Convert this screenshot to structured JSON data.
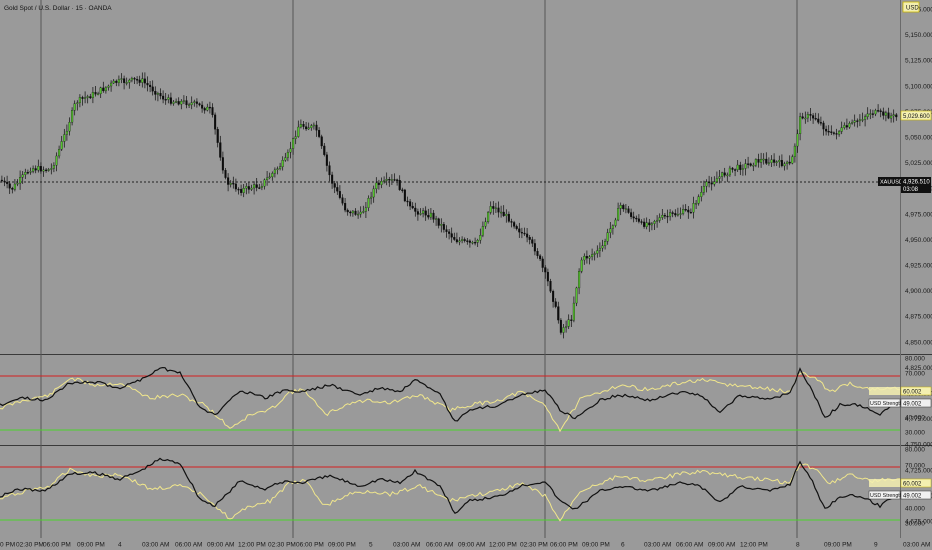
{
  "title": "Gold Spot / U.S. Dollar · 15 · OANDA",
  "currency_button": "USD",
  "price_axis": [
    "5,175.000",
    "5,150.000",
    "5,125.000",
    "5,100.000",
    "5,075.000",
    "5,050.000",
    "5,025.000",
    "5,000.000",
    "4,975.000",
    "4,950.000",
    "4,925.000",
    "4,900.000",
    "4,875.000",
    "4,850.000",
    "4,825.000",
    "4,800.000",
    "4,775.000",
    "4,750.000",
    "4,725.000",
    "4,700.000",
    "4,675.000"
  ],
  "last_price_tag": "5,029.600",
  "crosshair_tag": {
    "symbol": "XAUUSD",
    "price": "4,926.510",
    "time": "03:08"
  },
  "indicator_axis": [
    "80.000",
    "70.000",
    "60.000",
    "40.000",
    "30.000"
  ],
  "indicator1": {
    "value_tag": "60.002",
    "label_tag": "USD Strength",
    "label_value": "49.002"
  },
  "indicator2": {
    "value_tag": "60.002",
    "label_tag": "USD Strength",
    "label_value": "49.002"
  },
  "time_axis": [
    "0 PM",
    "02:30 PM",
    "06:00 PM",
    "09:00 PM",
    "4",
    "03:00 AM",
    "06:00 AM",
    "09:00 AM",
    "12:00 PM",
    "02:30 PM",
    "06:00 PM",
    "09:00 PM",
    "5",
    "03:00 AM",
    "06:00 AM",
    "09:00 AM",
    "12:00 PM",
    "02:30 PM",
    "06:00 PM",
    "09:00 PM",
    "6",
    "03:00 AM",
    "06:00 AM",
    "09:00 AM",
    "12:00 PM",
    "8",
    "09:00 PM",
    "9",
    "03:00 AM"
  ],
  "colors": {
    "background": "#9a9a9a",
    "bull_candle": "#56c22f",
    "bear_candle": "#0d0d0d",
    "overbought_line": "#d42020",
    "oversold_line": "#4bd42a",
    "strength_line_a": "#111111",
    "strength_line_b": "#f0e68c"
  }
}
